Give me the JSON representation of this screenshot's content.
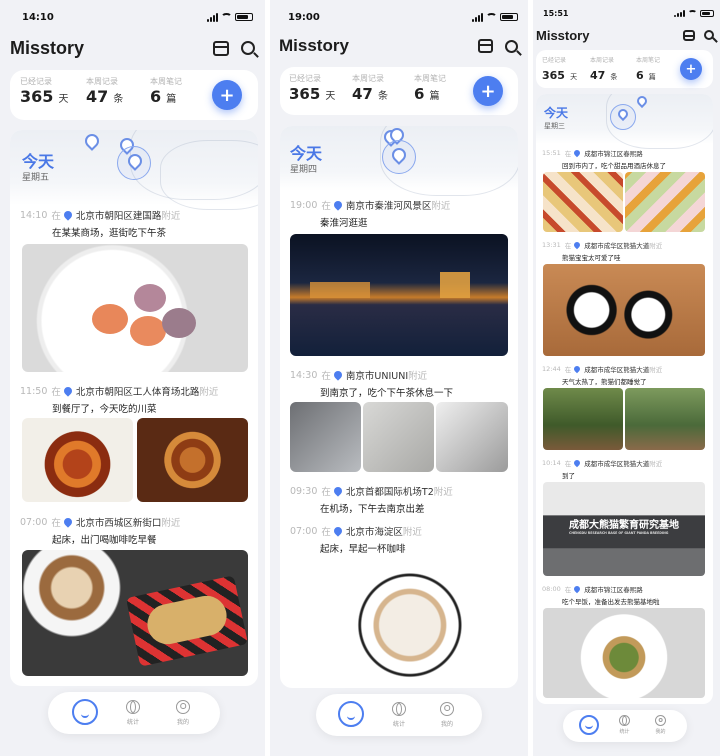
{
  "phones": [
    {
      "status_time": "14:10",
      "app_title": "Misstory",
      "stats": [
        {
          "label": "已经记录",
          "value": "365",
          "unit": "天"
        },
        {
          "label": "本周记录",
          "value": "47",
          "unit": "条"
        },
        {
          "label": "本周笔记",
          "value": "6",
          "unit": "篇"
        }
      ],
      "add_symbol": "+",
      "today": "今天",
      "weekday": "星期五",
      "entries": [
        {
          "time": "14:10",
          "zai": "在",
          "place": "北京市朝阳区建国路",
          "near": "附近",
          "note": "在某某商场，逛街吃下午茶"
        },
        {
          "time": "11:50",
          "zai": "在",
          "place": "北京市朝阳区工人体育场北路",
          "near": "附近",
          "note": "到餐厅了，今天吃的川菜"
        },
        {
          "time": "07:00",
          "zai": "在",
          "place": "北京市西城区新街口",
          "near": "附近",
          "note": "起床，出门喝咖啡吃早餐"
        }
      ],
      "nav": {
        "home": "",
        "stats": "统计",
        "mine": "我的"
      }
    },
    {
      "status_time": "19:00",
      "app_title": "Misstory",
      "stats": [
        {
          "label": "已经记录",
          "value": "365",
          "unit": "天"
        },
        {
          "label": "本周记录",
          "value": "47",
          "unit": "条"
        },
        {
          "label": "本周笔记",
          "value": "6",
          "unit": "篇"
        }
      ],
      "add_symbol": "+",
      "today": "今天",
      "weekday": "星期四",
      "entries": [
        {
          "time": "19:00",
          "zai": "在",
          "place": "南京市秦淮河风景区",
          "near": "附近",
          "note": "秦淮河逛逛"
        },
        {
          "time": "14:30",
          "zai": "在",
          "place": "南京市UNIUNI",
          "near": "附近",
          "note": "到南京了，吃个下午茶休息一下"
        },
        {
          "time": "09:30",
          "zai": "在",
          "place": "北京首都国际机场T2",
          "near": "附近",
          "note": "在机场，下午去南京出差"
        },
        {
          "time": "07:00",
          "zai": "在",
          "place": "北京市海淀区",
          "near": "附近",
          "note": "起床，早起一杯咖啡"
        }
      ],
      "nav": {
        "home": "",
        "stats": "统计",
        "mine": "我的"
      }
    },
    {
      "status_time": "15:51",
      "app_title": "Misstory",
      "stats": [
        {
          "label": "已经记录",
          "value": "365",
          "unit": "天"
        },
        {
          "label": "本周记录",
          "value": "47",
          "unit": "条"
        },
        {
          "label": "本周笔记",
          "value": "6",
          "unit": "篇"
        }
      ],
      "add_symbol": "+",
      "today": "今天",
      "weekday": "星期三",
      "entries": [
        {
          "time": "15:51",
          "zai": "在",
          "place": "成都市锦江区春熙路",
          "near": "",
          "note": "回到市内了，吃个甜品用酒店休息了"
        },
        {
          "time": "13:31",
          "zai": "在",
          "place": "成都市成华区熊猫大道",
          "near": "附近",
          "note": "熊猫宝宝太可爱了哇"
        },
        {
          "time": "12:44",
          "zai": "在",
          "place": "成都市成华区熊猫大道",
          "near": "附近",
          "note": "天气太热了，熊猫们都睡觉了"
        },
        {
          "time": "10:14",
          "zai": "在",
          "place": "成都市成华区熊猫大道",
          "near": "附近",
          "note": "到了"
        },
        {
          "time": "08:00",
          "zai": "在",
          "place": "成都市锦江区春熙路",
          "near": "",
          "note": "吃个早饭，准备出发去熊猫基地啦"
        }
      ],
      "building_text": "成都大熊猫繁育研究基地",
      "building_subtext": "CHENGDU RESEARCH BASE OF GIANT PANDA BREEDING",
      "nav": {
        "home": "",
        "stats": "统计",
        "mine": "我的"
      }
    }
  ],
  "colors": {
    "accent": "#4d7ef0",
    "muted": "#b8b8b8",
    "background": "#f1f2f6"
  }
}
